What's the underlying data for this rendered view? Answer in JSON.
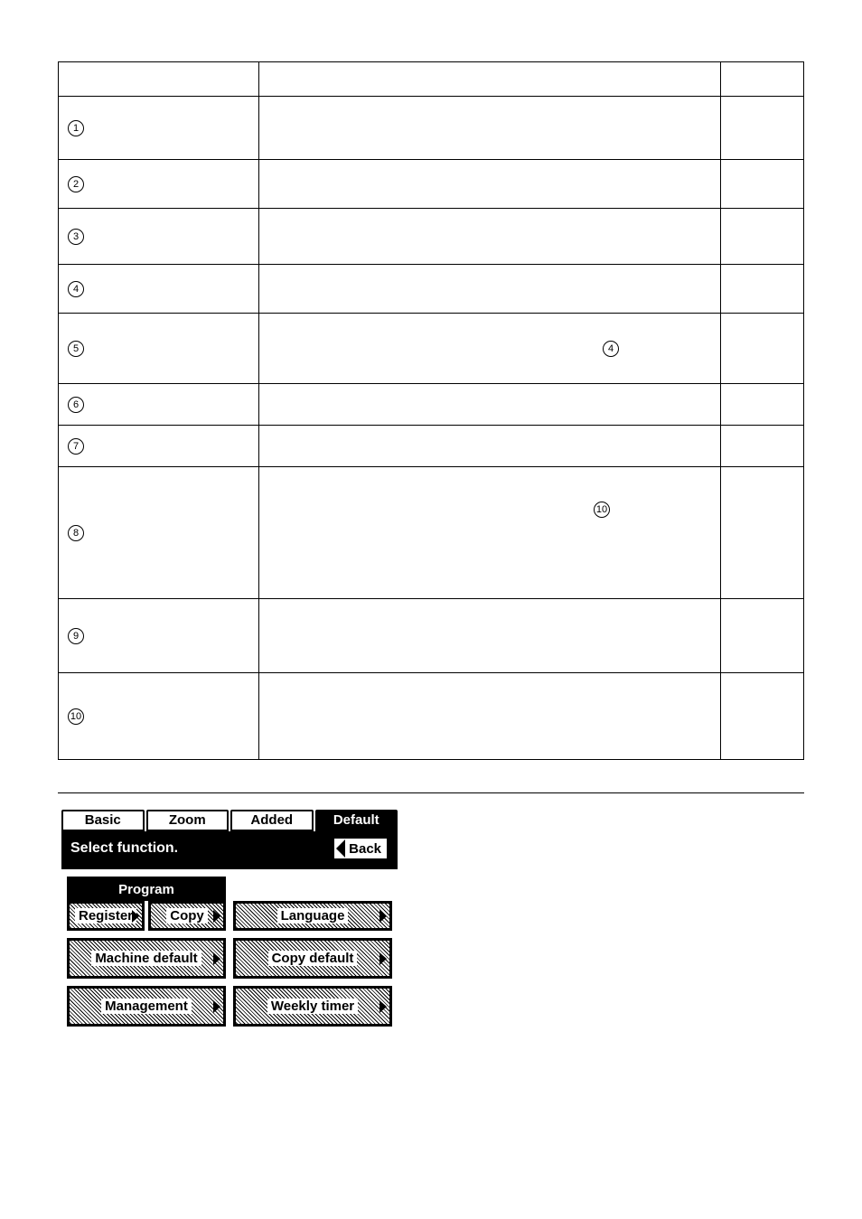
{
  "table": {
    "rows": [
      {
        "num": "1",
        "inline_ref": null
      },
      {
        "num": "2",
        "inline_ref": null
      },
      {
        "num": "3",
        "inline_ref": null
      },
      {
        "num": "4",
        "inline_ref": null
      },
      {
        "num": "5",
        "inline_ref": "4"
      },
      {
        "num": "6",
        "inline_ref": null
      },
      {
        "num": "7",
        "inline_ref": null
      },
      {
        "num": "8",
        "inline_ref": "10"
      },
      {
        "num": "9",
        "inline_ref": null
      },
      {
        "num": "10",
        "inline_ref": null
      }
    ]
  },
  "lcd": {
    "tabs": {
      "basic": "Basic",
      "zoom": "Zoom",
      "added": "Added",
      "default": "Default"
    },
    "header": {
      "title": "Select function.",
      "back": "Back"
    },
    "program": {
      "group_label": "Program",
      "register": "Register",
      "copy": "Copy"
    },
    "language": "Language",
    "machine_default": "Machine default",
    "copy_default": "Copy default",
    "management": "Management",
    "weekly_timer": "Weekly timer"
  }
}
